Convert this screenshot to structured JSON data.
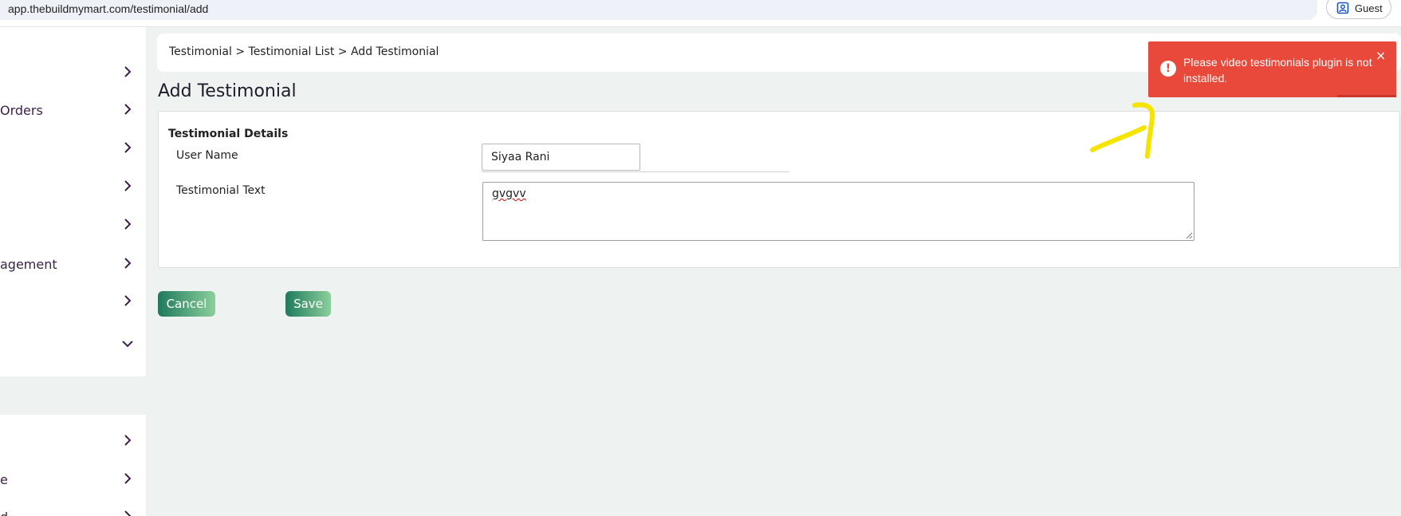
{
  "browser": {
    "url": "app.thebuildmymart.com/testimonial/add",
    "profile_label": "Guest"
  },
  "sidebar": {
    "items": [
      {
        "label": ""
      },
      {
        "label": "Orders"
      },
      {
        "label": ""
      },
      {
        "label": ""
      },
      {
        "label": ""
      },
      {
        "label": "agement"
      },
      {
        "label": ""
      },
      {
        "label": ""
      },
      {
        "label": ""
      },
      {
        "label": "e"
      },
      {
        "label": "d"
      }
    ]
  },
  "breadcrumb": "Testimonial > Testimonial List > Add Testimonial",
  "page_title": "Add Testimonial",
  "form": {
    "section_title": "Testimonial Details",
    "user_name_label": "User Name",
    "user_name_value": "Siyaa Rani",
    "testimonial_text_label": "Testimonial Text",
    "testimonial_text_value": "gvgvv"
  },
  "buttons": {
    "cancel": "Cancel",
    "save": "Save"
  },
  "toast": {
    "message": "Please video testimonials plugin is not installed.",
    "close": "×",
    "icon": "!"
  },
  "colors": {
    "accent_start": "#1f7a5c",
    "accent_end": "#8ccf9c",
    "toast_bg": "#e8493a",
    "annotation": "#f5e400"
  }
}
